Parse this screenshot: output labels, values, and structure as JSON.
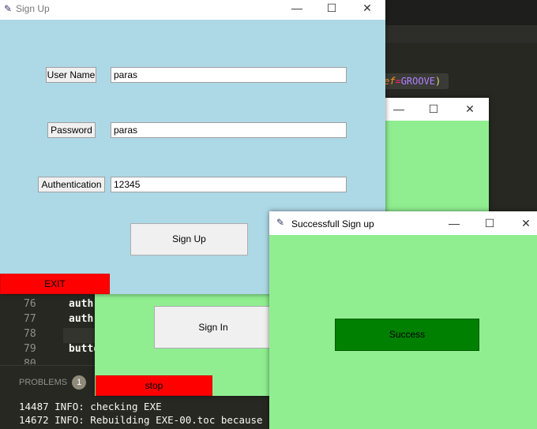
{
  "editor": {
    "code_snippet": {
      "kw": "ef",
      "op": "=",
      "val": "GROOVE",
      "paren": ")"
    },
    "lines": [
      {
        "no": "76",
        "code": "auth"
      },
      {
        "no": "77",
        "code": "auth"
      },
      {
        "no": "78",
        "code": ""
      },
      {
        "no": "79",
        "code": "butto"
      },
      {
        "no": "80",
        "code": ""
      }
    ],
    "panel": {
      "problems_label": "PROBLEMS",
      "problems_count": "1",
      "log": [
        "14487 INFO: checking EXE",
        "14672 INFO: Rebuilding EXE-00.toc because"
      ]
    }
  },
  "signin_window": {
    "sign_in_label": "Sign In",
    "stop_label": "stop",
    "bg": "#90ee90"
  },
  "signup_window": {
    "title": "Sign Up",
    "bg": "#add8e6",
    "fields": [
      {
        "label": "User Name",
        "value": "paras"
      },
      {
        "label": "Password",
        "value": "paras"
      },
      {
        "label": "Authentication",
        "value": "12345"
      }
    ],
    "submit_label": "Sign Up",
    "exit_label": "EXIT"
  },
  "success_window": {
    "title": "Successfull Sign up",
    "button_label": "Success",
    "bg": "#90ee90",
    "button_color": "#008000"
  },
  "controls": {
    "minimize": "—",
    "maximize": "☐",
    "close": "✕"
  }
}
